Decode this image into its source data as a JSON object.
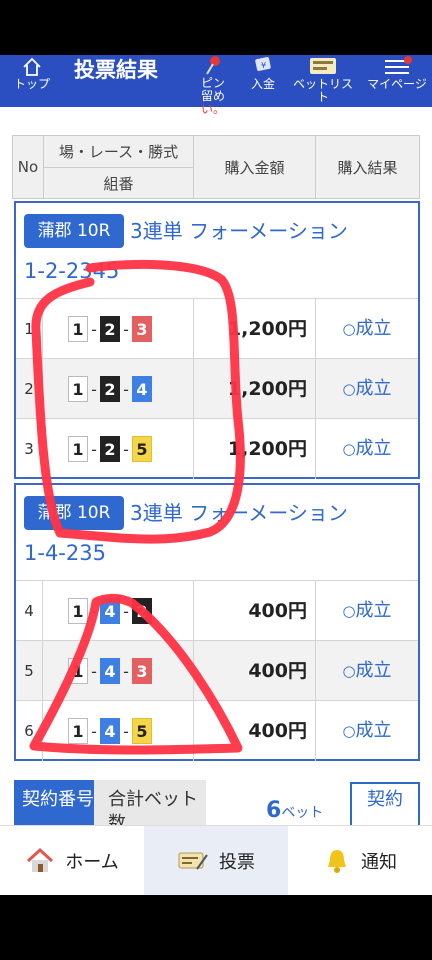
{
  "header": {
    "title": "投票結果",
    "nav": [
      {
        "label": "トップ",
        "icon": "home-icon"
      },
      {
        "label": "ピン留め",
        "label2": "い。",
        "icon": "pin-icon"
      },
      {
        "label": "入金",
        "icon": "deposit-icon"
      },
      {
        "label": "ベットリスト",
        "icon": "betlist-icon"
      },
      {
        "label": "マイページ",
        "icon": "menu-icon"
      }
    ]
  },
  "table": {
    "headers": {
      "no": "No",
      "race": "場・レース・勝式",
      "combo": "組番",
      "amount": "購入金額",
      "result": "購入結果"
    }
  },
  "blocks": [
    {
      "venue": "蒲郡 10R",
      "bet_type": "3連単 フォーメーション",
      "combo_text": "1-2-2345",
      "rows": [
        {
          "no": "1",
          "combo": [
            1,
            2,
            3
          ],
          "amount": "1,200円",
          "result": "成立"
        },
        {
          "no": "2",
          "combo": [
            1,
            2,
            4
          ],
          "amount": "1,200円",
          "result": "成立"
        },
        {
          "no": "3",
          "combo": [
            1,
            2,
            5
          ],
          "amount": "1,200円",
          "result": "成立"
        }
      ]
    },
    {
      "venue": "蒲郡 10R",
      "bet_type": "3連単 フォーメーション",
      "combo_text": "1-4-235",
      "rows": [
        {
          "no": "4",
          "combo": [
            1,
            4,
            2
          ],
          "amount": "400円",
          "result": "成立"
        },
        {
          "no": "5",
          "combo": [
            1,
            4,
            3
          ],
          "amount": "400円",
          "result": "成立"
        },
        {
          "no": "6",
          "combo": [
            1,
            4,
            5
          ],
          "amount": "400円",
          "result": "成立"
        }
      ]
    }
  ],
  "summary": {
    "contract_label": "契約番号",
    "total_label": "合計ベット数",
    "total_value": "6",
    "total_unit": "ベット",
    "contract_button": "契約"
  },
  "footer": {
    "items": [
      {
        "label": "ホーム",
        "icon": "home-icon"
      },
      {
        "label": "投票",
        "icon": "ticket-icon",
        "active": true
      },
      {
        "label": "通知",
        "icon": "bell-icon"
      }
    ]
  },
  "colors": {
    "header_bg": "#2b4fc0",
    "accent": "#2f68cf",
    "annotation": "#ff3344"
  }
}
